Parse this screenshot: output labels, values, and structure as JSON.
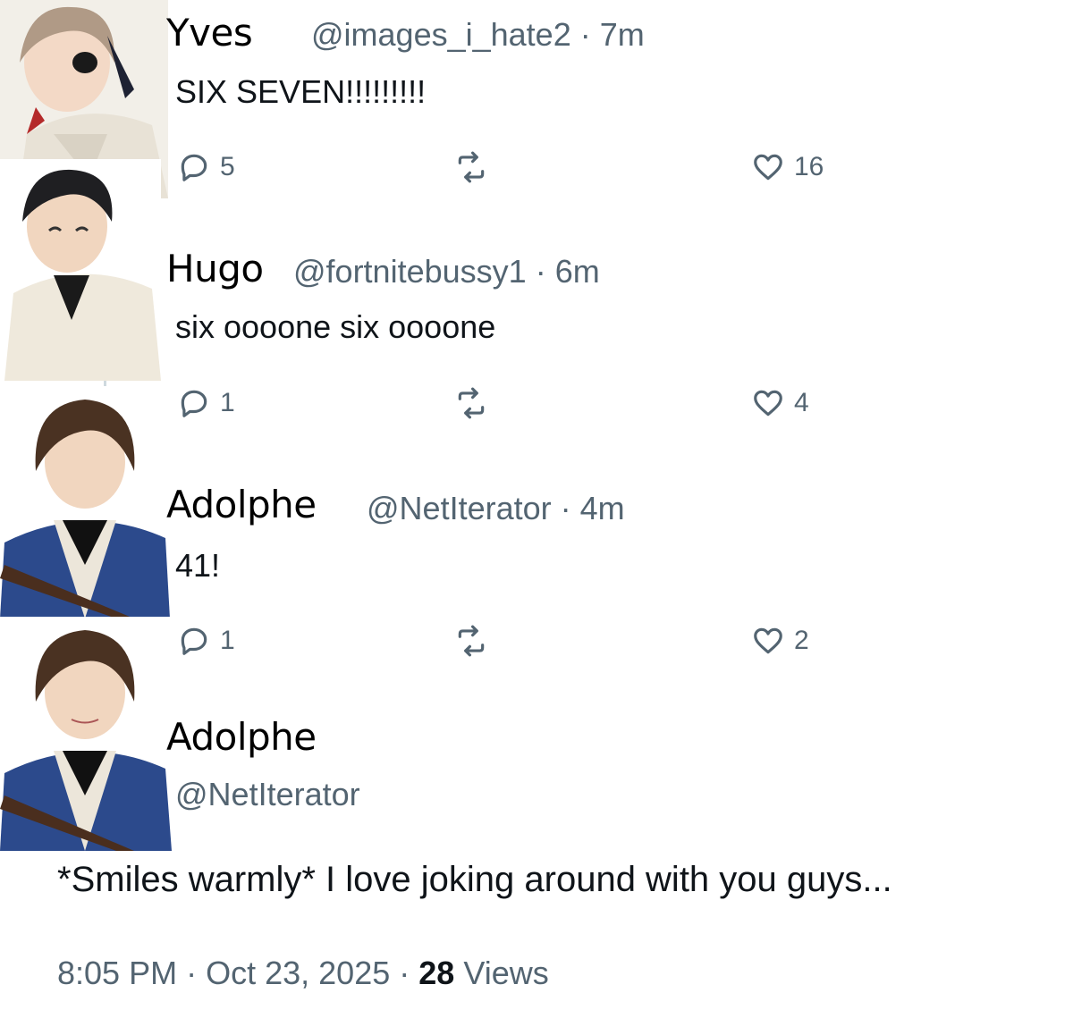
{
  "posts": [
    {
      "name": "Yves",
      "handle": "@images_i_hate2",
      "time": "7m",
      "text": "SIX SEVEN!!!!!!!!!",
      "replies": "5",
      "likes": "16"
    },
    {
      "name": "Hugo",
      "handle": "@fortnitebussy1",
      "time": "6m",
      "text": "six oooone six oooone",
      "replies": "1",
      "likes": "4"
    },
    {
      "name": "Adolphe",
      "handle": "@NetIterator",
      "time": "4m",
      "text": "41!",
      "replies": "1",
      "likes": "2"
    }
  ],
  "main_post": {
    "name": "Adolphe",
    "handle": "@NetIterator",
    "text": "*Smiles warmly* I love joking around with you guys...",
    "time": "8:05 PM",
    "date": "Oct 23, 2025",
    "views_count": "28",
    "views_label": "Views"
  },
  "separator": "·",
  "icons": {
    "reply": "reply-icon",
    "retweet": "retweet-icon",
    "like": "heart-icon"
  },
  "colors": {
    "muted": "#536471",
    "text": "#0f1419",
    "thread_line": "#cfd9de"
  }
}
